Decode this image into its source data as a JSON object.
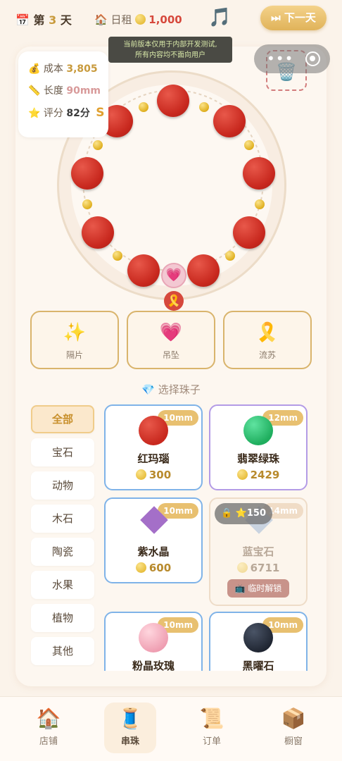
{
  "header": {
    "calendar_icon": "📅",
    "day_prefix": "第",
    "day_num": "3",
    "day_suffix": "天",
    "rent_icon": "🏠",
    "rent_label": "日租",
    "rent_amount": "1,000",
    "music_icon": "🎵",
    "next_button": "⏭ 下一天"
  },
  "notice": {
    "line1": "当前版本仅用于内部开发测试,",
    "line2": "所有内容均不面向用户"
  },
  "capsule": {
    "more": "•••"
  },
  "trash_icon": "🗑️",
  "stats": {
    "cost_icon": "💰",
    "cost_label": "成本",
    "cost_value": "3,805",
    "length_icon": "📏",
    "length_label": "长度",
    "length_value": "90mm",
    "score_icon": "⭐",
    "score_label": "评分",
    "score_value": "82分",
    "grade": "S"
  },
  "bracelet": {
    "pendant_icon": "💗",
    "tassel_icon": "🎗️"
  },
  "accessories": [
    {
      "icon": "✨",
      "label": "隔片"
    },
    {
      "icon": "💗",
      "label": "吊坠"
    },
    {
      "icon": "🎗️",
      "label": "流苏"
    }
  ],
  "section_title": "💎 选择珠子",
  "categories": [
    "全部",
    "宝石",
    "动物",
    "木石",
    "陶瓷",
    "水果",
    "植物",
    "其他"
  ],
  "beads": [
    {
      "name": "红玛瑙",
      "price": "300",
      "size": "10mm",
      "color": "#d6392e"
    },
    {
      "name": "翡翠绿珠",
      "price": "2429",
      "size": "12mm",
      "color": "#2fbf6e"
    },
    {
      "name": "紫水晶",
      "price": "600",
      "size": "10mm",
      "color": "#a46fc8"
    },
    {
      "name": "蓝宝石",
      "price": "6711",
      "size": "14mm",
      "color": "#c9d3e0",
      "lock": "🔒 ⭐150",
      "unlock": "📺 临时解锁"
    },
    {
      "name": "粉晶玫瑰",
      "price": "",
      "size": "10mm",
      "color": "#f3b6c4"
    },
    {
      "name": "黑曜石",
      "price": "",
      "size": "10mm",
      "color": "#2c3444"
    }
  ],
  "nav": [
    {
      "icon": "🏠",
      "label": "店铺"
    },
    {
      "icon": "🧵",
      "label": "串珠"
    },
    {
      "icon": "📜",
      "label": "订单"
    },
    {
      "icon": "📦",
      "label": "橱窗"
    }
  ]
}
